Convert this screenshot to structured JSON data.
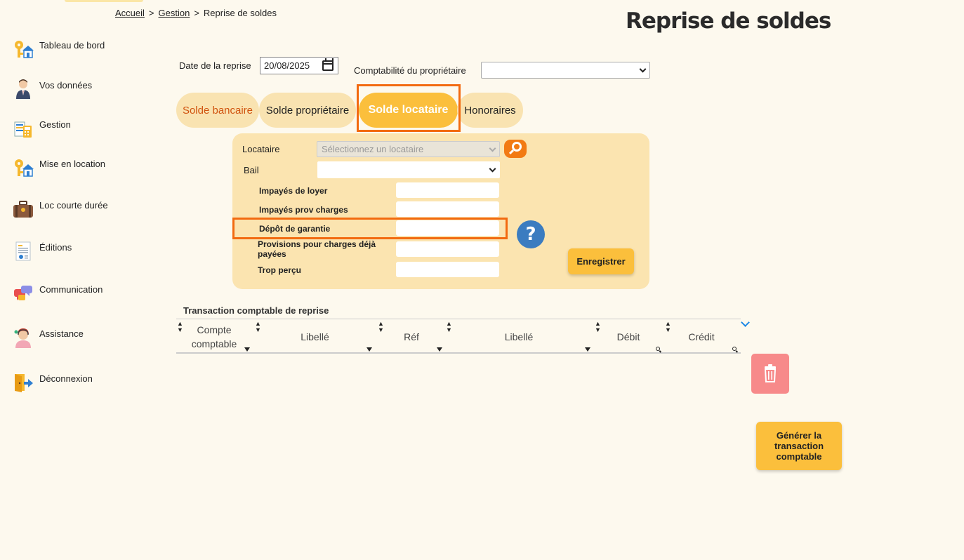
{
  "breadcrumb": {
    "home": "Accueil",
    "section": "Gestion",
    "current": "Reprise de soldes",
    "separator": ">"
  },
  "page_title": "Reprise de soldes",
  "sidebar": {
    "items": [
      {
        "label": "Tableau de bord",
        "icon": "keys-house-icon"
      },
      {
        "label": "Vos données",
        "icon": "user-icon"
      },
      {
        "label": "Gestion",
        "icon": "management-icon"
      },
      {
        "label": "Mise en location",
        "icon": "keys-house-icon"
      },
      {
        "label": "Loc courte durée",
        "icon": "suitcase-icon"
      },
      {
        "label": "Éditions",
        "icon": "document-icon"
      },
      {
        "label": "Communication",
        "icon": "chat-icon"
      },
      {
        "label": "Assistance",
        "icon": "support-icon"
      },
      {
        "label": "Déconnexion",
        "icon": "logout-icon"
      }
    ]
  },
  "filters": {
    "date_label": "Date de la reprise",
    "date_value": "20/08/2025",
    "owner_label": "Comptabilité du propriétaire",
    "owner_value": ""
  },
  "tabs": [
    {
      "label": "Solde bancaire",
      "active": false
    },
    {
      "label": "Solde propriétaire",
      "active": false
    },
    {
      "label": "Solde locataire",
      "active": true
    },
    {
      "label": "Honoraires",
      "active": false
    }
  ],
  "panel": {
    "tenant_label": "Locataire",
    "tenant_placeholder": "Sélectionnez un locataire",
    "lease_label": "Bail",
    "lease_value": "",
    "fields": [
      {
        "label": "Impayés de loyer",
        "value": ""
      },
      {
        "label": "Impayés prov charges",
        "value": ""
      },
      {
        "label": "Dépôt de garantie",
        "value": ""
      },
      {
        "label": "Provisions pour charges déjà payées",
        "value": ""
      },
      {
        "label": "Trop perçu",
        "value": ""
      }
    ],
    "help_label": "?",
    "save_label": "Enregistrer"
  },
  "table": {
    "title": "Transaction comptable de reprise",
    "columns": [
      "Compte comptable",
      "Libellé",
      "Réf",
      "Libellé",
      "Débit",
      "Crédit"
    ],
    "rows": []
  },
  "actions": {
    "generate_label": [
      "Générer la",
      "transaction",
      "comptable"
    ]
  },
  "colors": {
    "accent": "#fbbf3c",
    "tab_inactive": "#f9e3b1",
    "panel": "#fbe4b0",
    "highlight": "#f26a10",
    "delete": "#f78a8a",
    "help": "#3b7cc0"
  }
}
